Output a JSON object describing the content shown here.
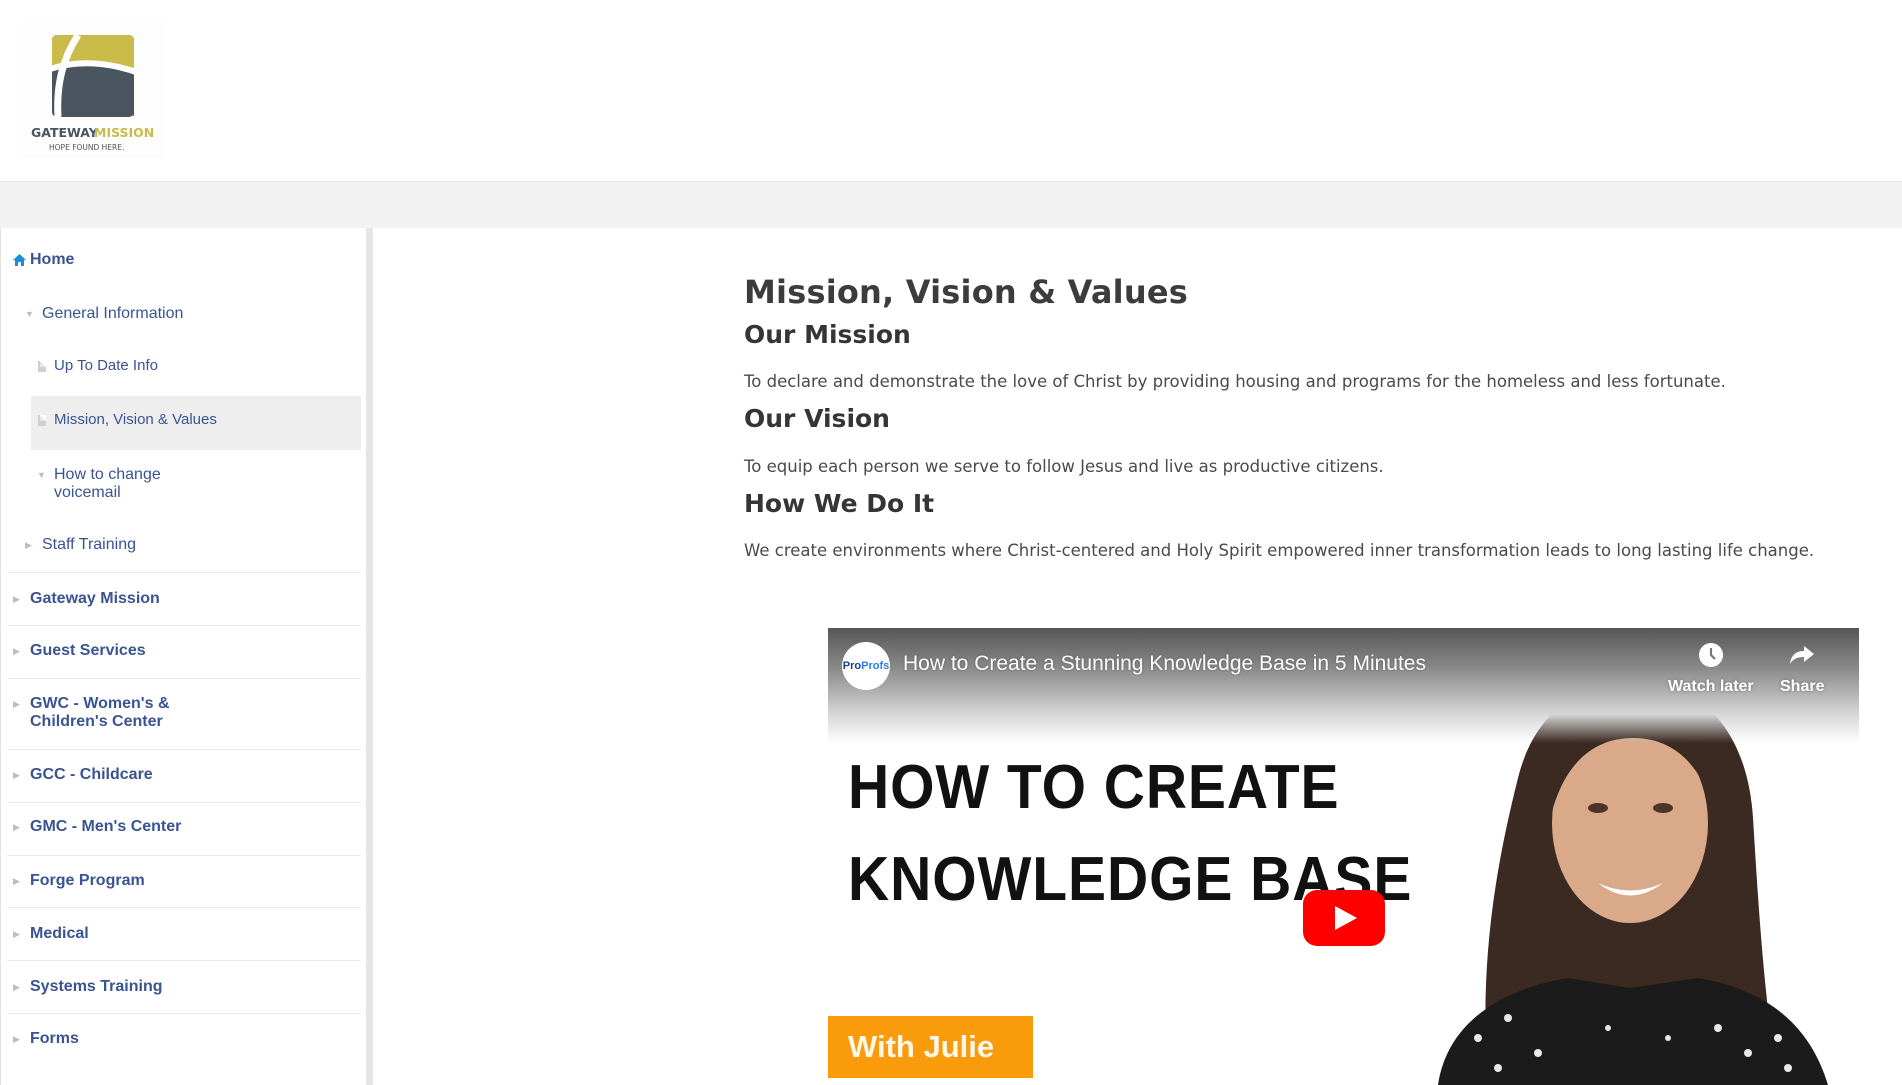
{
  "header": {
    "logo": {
      "name": "GATEWAY",
      "accent": "MISSION",
      "tagline": "HOPE FOUND HERE."
    }
  },
  "sidebar": {
    "home_label": "Home",
    "items": [
      {
        "label": "General Information",
        "level": 1,
        "expanded": true
      },
      {
        "label": "Up To Date Info",
        "level": 2,
        "type": "page"
      },
      {
        "label": "Mission, Vision & Values",
        "level": 2,
        "type": "page",
        "active": true
      },
      {
        "label": "How to change voicemail",
        "level": 2,
        "expanded": true
      },
      {
        "label": "Staff Training",
        "level": 1,
        "expanded": false
      },
      {
        "label": "Gateway Mission",
        "level": 0
      },
      {
        "label": "Guest Services",
        "level": 0
      },
      {
        "label": "GWC - Women's & Children's Center",
        "level": 0
      },
      {
        "label": "GCC - Childcare",
        "level": 0
      },
      {
        "label": "GMC - Men's Center",
        "level": 0
      },
      {
        "label": "Forge Program",
        "level": 0
      },
      {
        "label": "Medical",
        "level": 0
      },
      {
        "label": "Systems Training",
        "level": 0
      },
      {
        "label": "Forms",
        "level": 0
      }
    ],
    "voicemail_line1": "How to change",
    "voicemail_line2": "voicemail",
    "gwc_line1": "GWC - Women's &",
    "gwc_line2": "Children's Center"
  },
  "article": {
    "title": "Mission, Vision & Values",
    "sections": [
      {
        "heading": "Our Mission",
        "text": "To declare and demonstrate the love of Christ by providing housing and programs for the homeless and less fortunate."
      },
      {
        "heading": "Our Vision",
        "text": "To equip each person we serve to follow Jesus and live as productive citizens."
      },
      {
        "heading": "How We Do It",
        "text": "We create environments where Christ-centered and Holy Spirit empowered inner transformation leads to long lasting life change."
      }
    ]
  },
  "video": {
    "channel": "ProProfs",
    "channel_pro": "Pro",
    "channel_profs": "Profs",
    "title": "How to Create a Stunning Knowledge Base in 5 Minutes",
    "watch_later_label": "Watch later",
    "share_label": "Share",
    "thumbnail_line1": "HOW TO CREATE",
    "thumbnail_line2": "KNOWLEDGE BASE",
    "badge": "With Julie"
  },
  "colors": {
    "nav_text": "#3a5393",
    "home_icon": "#1a8fd6",
    "play_button": "#ff0000",
    "badge": "#f99b0b",
    "logo_gold": "#c9bc4a",
    "logo_slate": "#4a5560"
  }
}
